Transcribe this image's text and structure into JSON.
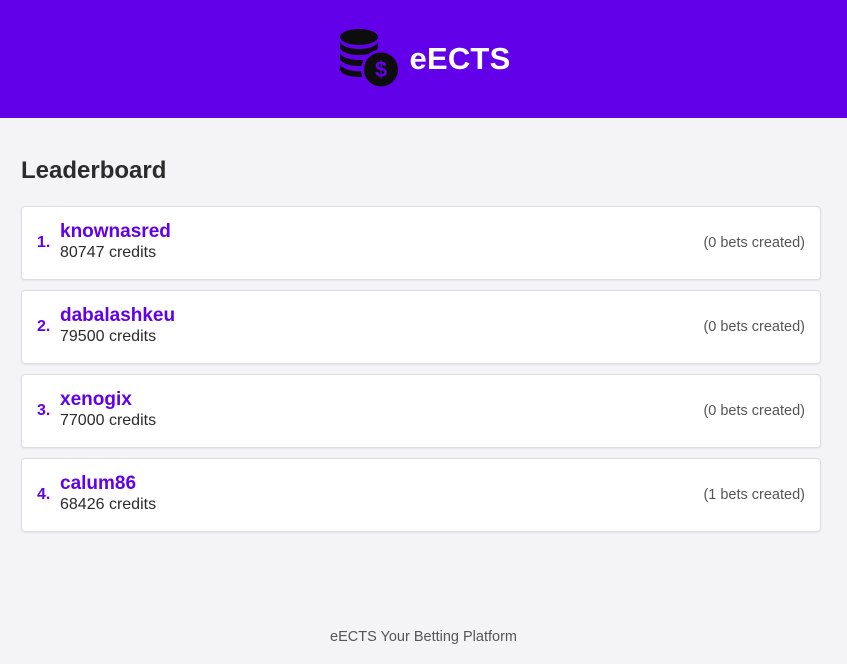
{
  "header": {
    "app_title": "eECTS",
    "logo_icon": "coins-dollar-icon",
    "background_color": "#6200ea"
  },
  "main": {
    "title": "Leaderboard",
    "accent_color": "#6200ea",
    "entries": [
      {
        "rank": "1.",
        "username": "knownasred",
        "credits": "80747 credits",
        "bets": "(0 bets created)"
      },
      {
        "rank": "2.",
        "username": "dabalashkeu",
        "credits": "79500 credits",
        "bets": "(0 bets created)"
      },
      {
        "rank": "3.",
        "username": "xenogix",
        "credits": "77000 credits",
        "bets": "(0 bets created)"
      },
      {
        "rank": "4.",
        "username": "calum86",
        "credits": "68426 credits",
        "bets": "(1 bets created)"
      }
    ]
  },
  "footer": {
    "text": "eECTS Your Betting Platform"
  }
}
